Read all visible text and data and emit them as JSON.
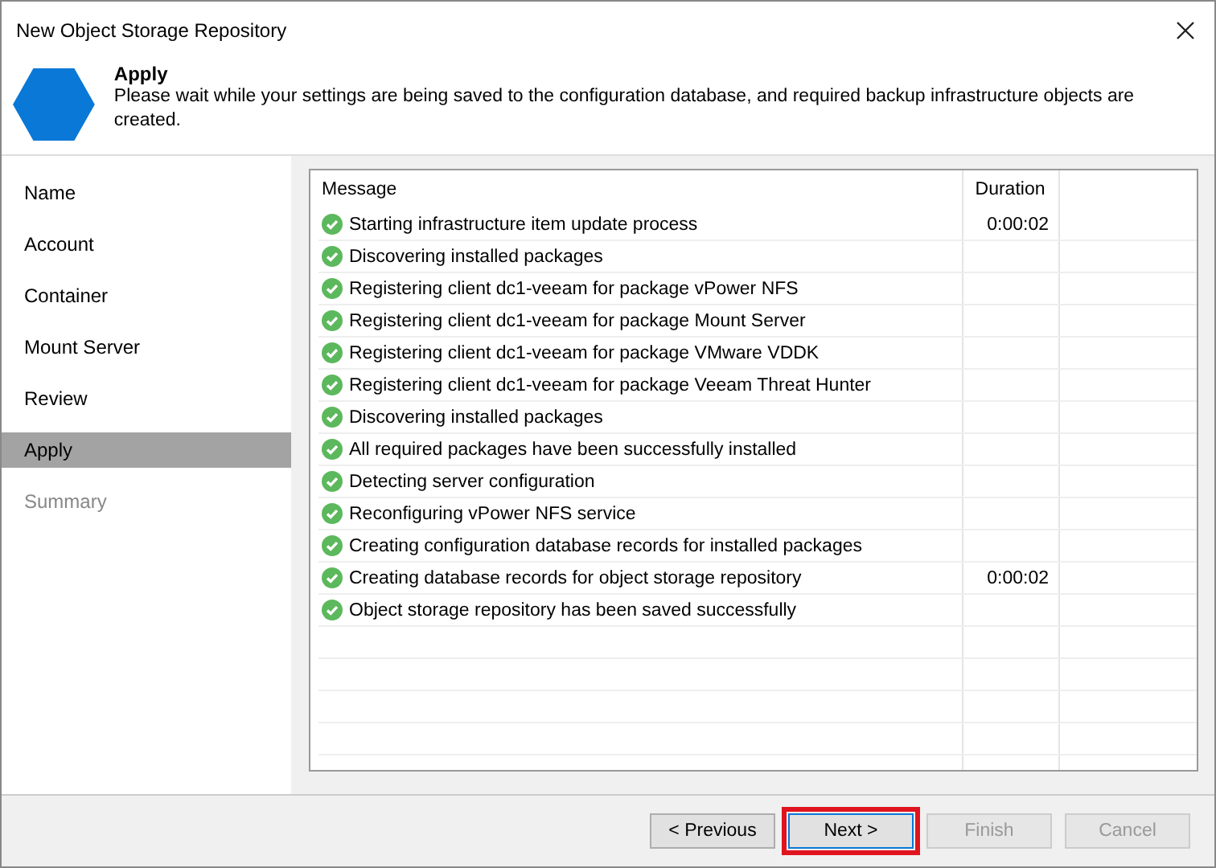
{
  "window": {
    "title": "New Object Storage Repository"
  },
  "header": {
    "title": "Apply",
    "description": "Please wait while your settings are being saved to the configuration database, and required backup infrastructure objects are created."
  },
  "sidebar": {
    "items": [
      {
        "label": "Name",
        "selected": false,
        "disabled": false
      },
      {
        "label": "Account",
        "selected": false,
        "disabled": false
      },
      {
        "label": "Container",
        "selected": false,
        "disabled": false
      },
      {
        "label": "Mount Server",
        "selected": false,
        "disabled": false
      },
      {
        "label": "Review",
        "selected": false,
        "disabled": false
      },
      {
        "label": "Apply",
        "selected": true,
        "disabled": false
      },
      {
        "label": "Summary",
        "selected": false,
        "disabled": true
      }
    ]
  },
  "log": {
    "columns": [
      "Message",
      "Duration"
    ],
    "rows": [
      {
        "kind": "success",
        "message": "Starting infrastructure item update process",
        "duration": "0:00:02"
      },
      {
        "kind": "success",
        "message": "Discovering installed packages"
      },
      {
        "kind": "success",
        "message": "Registering client dc1-veeam for package vPower NFS"
      },
      {
        "kind": "success",
        "message": "Registering client dc1-veeam for package Mount Server"
      },
      {
        "kind": "success",
        "message": "Registering client dc1-veeam for package VMware VDDK"
      },
      {
        "kind": "success",
        "message": "Registering client dc1-veeam for package Veeam Threat Hunter"
      },
      {
        "kind": "success",
        "message": "Discovering installed packages"
      },
      {
        "kind": "success",
        "message": "All required packages have been successfully installed"
      },
      {
        "kind": "success",
        "message": "Detecting server configuration"
      },
      {
        "kind": "success",
        "message": "Reconfiguring vPower NFS service"
      },
      {
        "kind": "success",
        "message": "Creating configuration database records for installed packages"
      },
      {
        "kind": "success",
        "message": "Creating database records for object storage repository",
        "duration": "0:00:02"
      },
      {
        "kind": "success",
        "message": "Object storage repository has been saved successfully"
      }
    ]
  },
  "buttons": [
    {
      "label": "< Previous",
      "disabled": false,
      "highlighted": false
    },
    {
      "label": "Next >",
      "disabled": false,
      "highlighted": true
    },
    {
      "label": "Finish",
      "disabled": true,
      "highlighted": false
    },
    {
      "label": "Cancel",
      "disabled": true,
      "highlighted": false
    }
  ]
}
